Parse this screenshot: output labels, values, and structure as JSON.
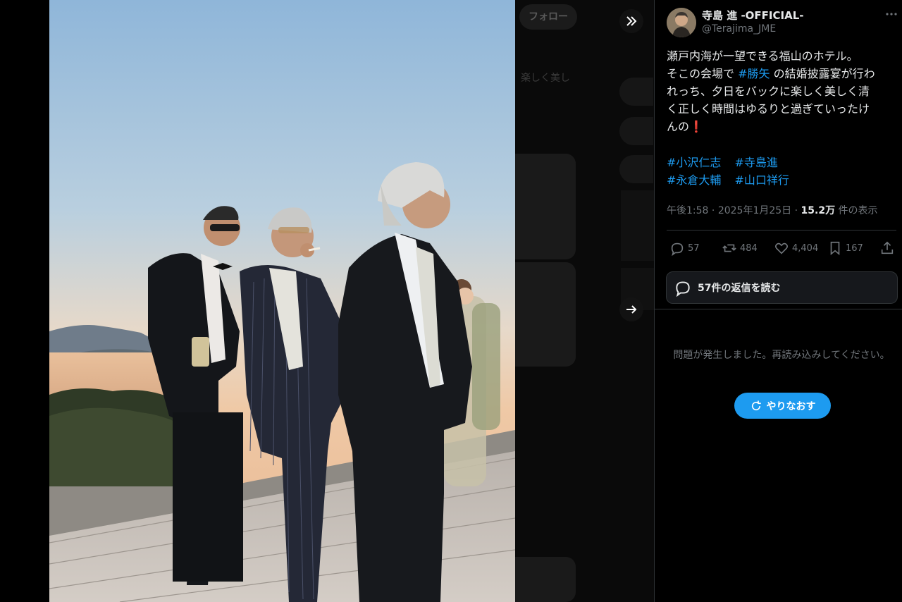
{
  "viewer": {
    "background_follow_label": "フォロー",
    "background_snippet_1": "楽しく美し",
    "photo_alt": "Three men in suits on a wooden deck at sunset overlooking the Seto Inland Sea"
  },
  "author": {
    "display_name": "寺島 進 -OFFICIAL-",
    "handle": "@Terajima_JME"
  },
  "tweet": {
    "line1": "瀬戸内海が一望できる福山のホテル。",
    "line2_pre": "そこの会場で ",
    "line2_tag": "#勝矢",
    "line2_post": " の結婚披露宴が行わ",
    "line3": "れっち、夕日をバックに楽しく美しく清",
    "line4": "く正しく時間はゆるりと過ぎていったけ",
    "line5": "んの",
    "line5_emoji": "❗",
    "tags": [
      "#小沢仁志",
      "#寺島進",
      "#永倉大輔",
      "#山口祥行"
    ]
  },
  "meta": {
    "time": "午後1:58",
    "sep": " · ",
    "date": "2025年1月25日",
    "views": "15.2万",
    "views_label": "件の表示"
  },
  "actions": {
    "replies": "57",
    "retweets": "484",
    "likes": "4,404",
    "bookmarks": "167"
  },
  "replies_button": "57件の返信を読む",
  "error": {
    "message": "問題が発生しました。再読み込みしてください。",
    "retry_label": "やりなおす"
  },
  "colors": {
    "accent": "#1d9bf0",
    "text": "#e7e9ea",
    "muted": "#71767b",
    "border": "#2f3336"
  }
}
